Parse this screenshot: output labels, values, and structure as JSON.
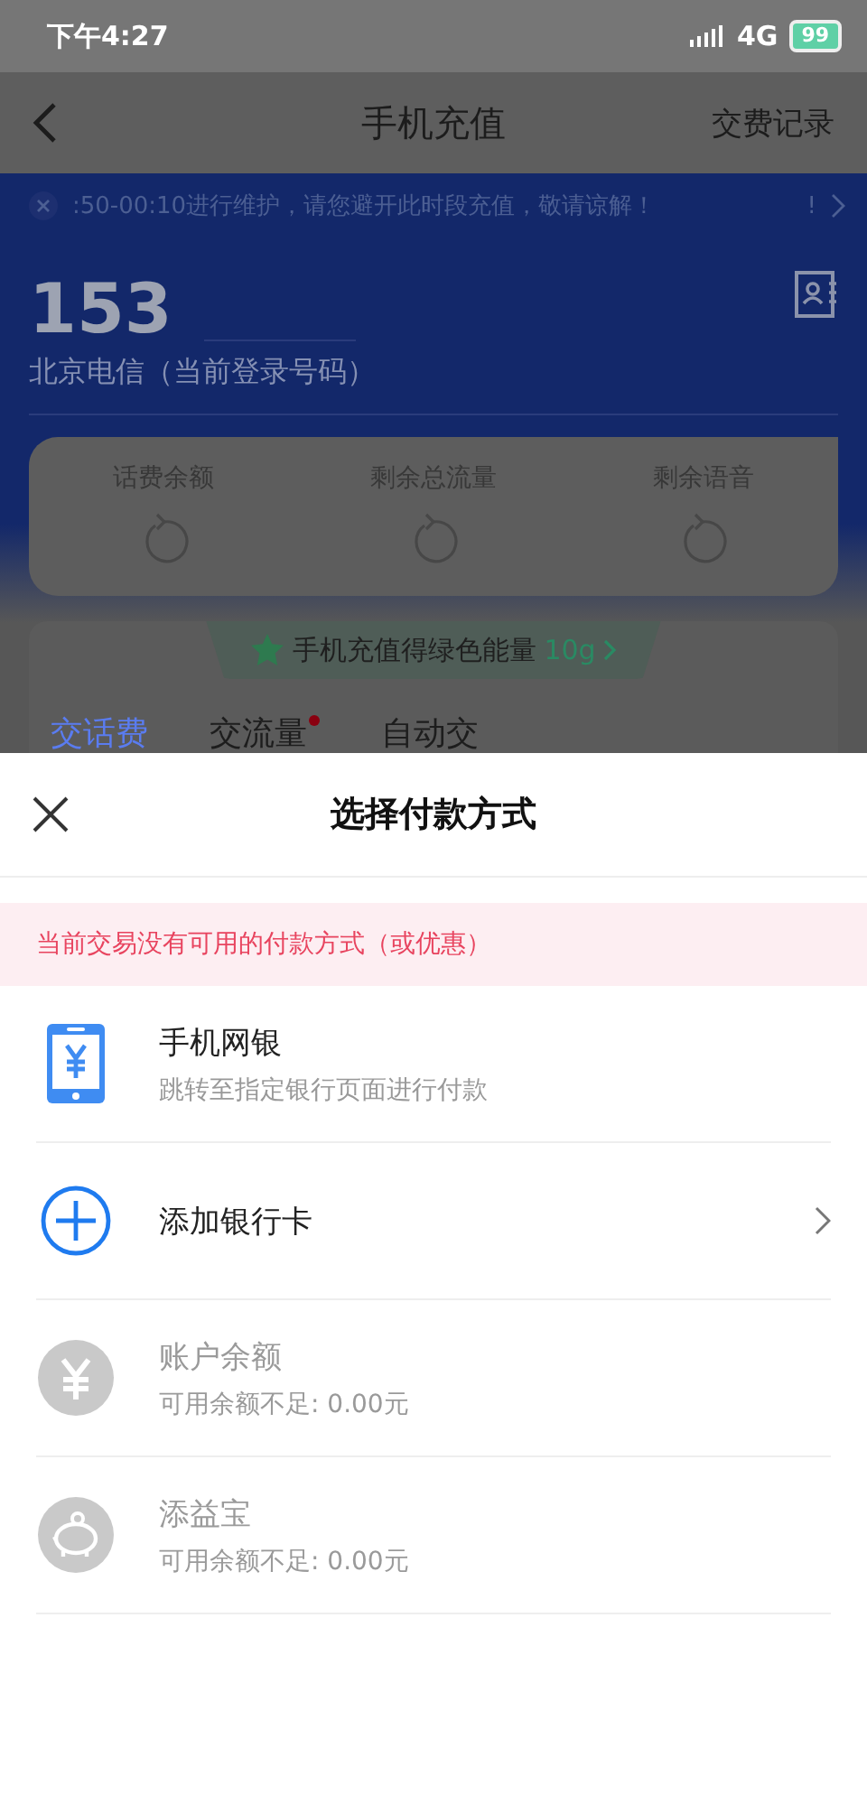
{
  "status_bar": {
    "time": "下午4:27",
    "network": "4G",
    "battery": "99"
  },
  "nav": {
    "title": "手机充值",
    "action": "交费记录"
  },
  "notice": {
    "text": ":50-00:10进行维护，请您避开此时段充值，敬请谅解！",
    "tail": "!"
  },
  "account": {
    "number": "153",
    "carrier": "北京电信（当前登录号码）"
  },
  "balances": [
    {
      "label": "话费余额"
    },
    {
      "label": "剩余总流量"
    },
    {
      "label": "剩余语音"
    }
  ],
  "promo": {
    "text": "手机充值得绿色能量",
    "amount": "10g"
  },
  "tabs": [
    {
      "label": "交话费",
      "selected": true,
      "badge": false
    },
    {
      "label": "交流量",
      "selected": false,
      "badge": true
    },
    {
      "label": "自动交",
      "selected": false,
      "badge": false
    }
  ],
  "sheet": {
    "title": "选择付款方式",
    "warning": "当前交易没有可用的付款方式（或优惠）",
    "methods": [
      {
        "kind": "bank_app",
        "title": "手机网银",
        "subtitle": "跳转至指定银行页面进行付款",
        "disabled": false
      },
      {
        "kind": "add_card",
        "title": "添加银行卡",
        "disabled": false
      },
      {
        "kind": "balance",
        "title": "账户余额",
        "subtitle": "可用余额不足: 0.00元",
        "disabled": true
      },
      {
        "kind": "piggy",
        "title": "添益宝",
        "subtitle": "可用余额不足: 0.00元",
        "disabled": true
      }
    ]
  }
}
